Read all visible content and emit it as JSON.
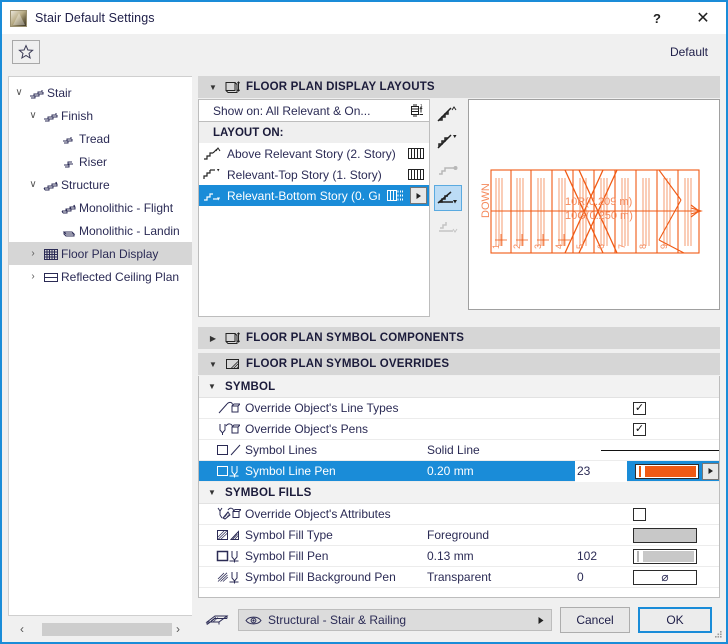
{
  "window": {
    "title": "Stair Default Settings",
    "app_icon": "stair-app-icon",
    "help_label": "?",
    "close_label": "✕"
  },
  "toolbar": {
    "favorites_icon": "star-icon",
    "default_label": "Default"
  },
  "tree": {
    "items": [
      {
        "label": "Stair",
        "depth": 0,
        "twisty": "∨",
        "icon": "stair-icon",
        "selected": false
      },
      {
        "label": "Finish",
        "depth": 1,
        "twisty": "∨",
        "icon": "stair-finish-icon",
        "selected": false
      },
      {
        "label": "Tread",
        "depth": 2,
        "twisty": "",
        "icon": "tread-icon",
        "selected": false
      },
      {
        "label": "Riser",
        "depth": 2,
        "twisty": "",
        "icon": "riser-icon",
        "selected": false
      },
      {
        "label": "Structure",
        "depth": 1,
        "twisty": "∨",
        "icon": "structure-icon",
        "selected": false
      },
      {
        "label": "Monolithic - Flight",
        "depth": 2,
        "twisty": "",
        "icon": "monolithic-flight-icon",
        "selected": false
      },
      {
        "label": "Monolithic - Landin",
        "depth": 2,
        "twisty": "",
        "icon": "monolithic-landing-icon",
        "selected": false
      },
      {
        "label": "Floor Plan Display",
        "depth": 1,
        "twisty": "›",
        "icon": "floor-plan-display-icon",
        "selected": true
      },
      {
        "label": "Reflected Ceiling Plan",
        "depth": 1,
        "twisty": "›",
        "icon": "reflected-ceiling-plan-icon",
        "selected": false
      }
    ],
    "scrollbar": {
      "left_arrow": "‹",
      "right_arrow": "›"
    }
  },
  "sections": {
    "layouts": {
      "title": "FLOOR PLAN DISPLAY LAYOUTS",
      "triangle": "▼",
      "icon": "floor-plan-layouts-icon",
      "show_on": "Show on: All Relevant & On...",
      "show_on_icon": "story-levels-icon",
      "list_caption": "LAYOUT ON:",
      "rows": [
        {
          "label": "Above Relevant Story (2. Story)",
          "icon": "stair-above-icon",
          "pattern": "hatch-pattern-solid",
          "selected": false,
          "more": false
        },
        {
          "label": "Relevant-Top Story (1. Story)",
          "icon": "stair-top-icon",
          "pattern": "hatch-pattern-solid",
          "selected": false,
          "more": false
        },
        {
          "label": "Relevant-Bottom Story (0. Gr...",
          "icon": "stair-bottom-icon",
          "pattern": "hatch-pattern-dashed",
          "selected": true,
          "more": true,
          "more_icon": "play-arrow-icon"
        }
      ],
      "strip_buttons": [
        {
          "name": "stair-display-above-icon",
          "active": false,
          "dim": false
        },
        {
          "name": "stair-display-top-icon",
          "active": false,
          "dim": false
        },
        {
          "name": "stair-display-middle-icon",
          "active": false,
          "dim": true
        },
        {
          "name": "stair-display-bottom-icon",
          "active": true,
          "dim": false
        },
        {
          "name": "stair-display-hidden-icon",
          "active": false,
          "dim": true
        }
      ]
    },
    "components": {
      "title": "FLOOR PLAN SYMBOL COMPONENTS",
      "triangle": "▶",
      "icon": "floor-plan-components-icon"
    },
    "overrides": {
      "title": "FLOOR PLAN SYMBOL OVERRIDES",
      "triangle": "▼",
      "icon": "floor-plan-overrides-icon",
      "groups": [
        {
          "label": "SYMBOL",
          "triangle": "▼",
          "rows": [
            {
              "name": "Override Object's Line Types",
              "icon": "override-line-types-icon",
              "value": "",
              "number": "",
              "control": "checkbox",
              "checked": true,
              "selected": false
            },
            {
              "name": "Override Object's Pens",
              "icon": "override-pens-icon",
              "value": "",
              "number": "",
              "control": "checkbox",
              "checked": true,
              "selected": false
            },
            {
              "name": "Symbol Lines",
              "icon": "symbol-lines-icon",
              "value": "Solid Line",
              "number": "",
              "control": "linepreview",
              "selected": false
            },
            {
              "name": "Symbol Line Pen",
              "icon": "symbol-line-pen-icon",
              "value": "0.20 mm",
              "number": "23",
              "control": "pen-swatch",
              "swatch_color": "#f05a14",
              "selected": true,
              "has_next": true,
              "next_icon": "play-arrow-icon"
            }
          ]
        },
        {
          "label": "SYMBOL FILLS",
          "triangle": "▼",
          "rows": [
            {
              "name": "Override Object's Attributes",
              "icon": "override-attributes-icon",
              "value": "",
              "number": "",
              "control": "checkbox",
              "checked": false,
              "selected": false
            },
            {
              "name": "Symbol Fill Type",
              "icon": "symbol-fill-type-icon",
              "value": "Foreground",
              "number": "",
              "control": "fill-swatch",
              "swatch_color": "#c8c8c8",
              "selected": false
            },
            {
              "name": "Symbol Fill Pen",
              "icon": "symbol-fill-pen-icon",
              "value": "0.13 mm",
              "number": "102",
              "control": "pen-swatch",
              "swatch_color": "#c8c8c8",
              "selected": false,
              "has_next": false
            },
            {
              "name": "Symbol Fill Background Pen",
              "icon": "symbol-fill-bg-pen-icon",
              "value": "Transparent",
              "number": "0",
              "control": "transparent-swatch",
              "swatch_glyph": "⌀",
              "selected": false
            }
          ]
        }
      ]
    }
  },
  "preview": {
    "name": "stair-floor-plan-preview",
    "line_color": "#f05a14",
    "label_color": "#f58a5c",
    "riser_label": "10R(0.209 m)",
    "going_label": "10G(0.250 m)",
    "direction_label": "DOWN",
    "tread_numbers": [
      "1",
      "2",
      "3",
      "4",
      "5",
      "6",
      "7",
      "8",
      "9"
    ]
  },
  "bottom": {
    "layer_icon": "layers-icon",
    "eye_icon": "eye-icon",
    "layer_name": "Structural - Stair & Railing",
    "layer_arrow": "▶",
    "cancel_label": "Cancel",
    "ok_label": "OK"
  },
  "colors": {
    "accent": "#1a8cd8",
    "selection": "#1a8cd8",
    "orange": "#f05a14",
    "header_gray": "#d6d6d6"
  }
}
